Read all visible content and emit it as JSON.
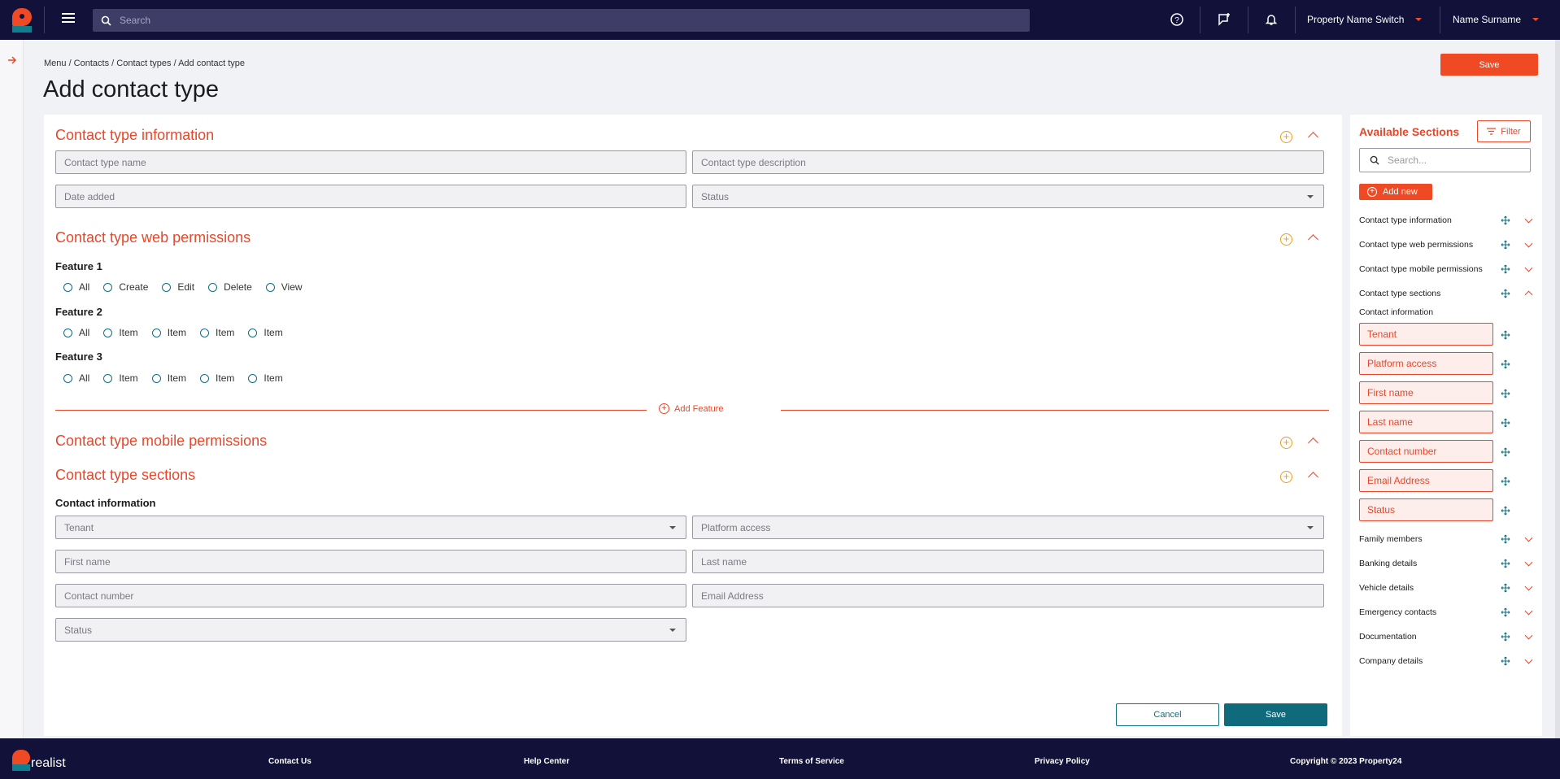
{
  "colors": {
    "nav": "#11113a",
    "accent": "#f04a24",
    "teal": "#0f6a7c",
    "warn": "#f39c12"
  },
  "topbar": {
    "search_placeholder": "Search",
    "property_switch": "Property Name Switch",
    "user_name": "Name Surname"
  },
  "breadcrumb": "Menu / Contacts / Contact types / Add contact type",
  "page_title": "Add contact type",
  "save_label": "Save",
  "sections": {
    "info": {
      "title": "Contact type information",
      "name_placeholder": "Contact type name",
      "desc_placeholder": "Contact type description",
      "date_placeholder": "Date added",
      "status_label": "Status"
    },
    "web": {
      "title": "Contact type web permissions",
      "features": [
        {
          "name": "Feature 1",
          "options": [
            "All",
            "Create",
            "Edit",
            "Delete",
            "View"
          ]
        },
        {
          "name": "Feature 2",
          "options": [
            "All",
            "Item",
            "Item",
            "Item",
            "Item"
          ]
        },
        {
          "name": "Feature 3",
          "options": [
            "All",
            "Item",
            "Item",
            "Item",
            "Item"
          ]
        }
      ],
      "add_feature": "Add Feature"
    },
    "mobile": {
      "title": "Contact type mobile permissions"
    },
    "sections": {
      "title": "Contact type sections",
      "subtitle": "Contact information",
      "tenant": "Tenant",
      "platform": "Platform access",
      "first": "First name",
      "last": "Last name",
      "contact_number": "Contact number",
      "email": "Email Address",
      "status": "Status"
    }
  },
  "actions": {
    "cancel": "Cancel",
    "save": "Save"
  },
  "sidebar": {
    "title": "Available Sections",
    "filter": "Filter",
    "search_placeholder": "Search...",
    "add_new": "Add new",
    "items_top": [
      "Contact type information",
      "Contact type web permissions",
      "Contact type mobile permissions",
      "Contact type sections"
    ],
    "subtitle": "Contact information",
    "chips": [
      "Tenant",
      "Platform access",
      "First name",
      "Last name",
      "Contact number",
      "Email Address",
      "Status"
    ],
    "items_bottom": [
      "Family members",
      "Banking details",
      "Vehicle details",
      "Emergency contacts",
      "Documentation",
      "Company details"
    ]
  },
  "footer": {
    "brand": "realist",
    "links": [
      "Contact Us",
      "Help Center",
      "Terms of Service",
      "Privacy Policy",
      "Copyright © 2023 Property24"
    ]
  }
}
